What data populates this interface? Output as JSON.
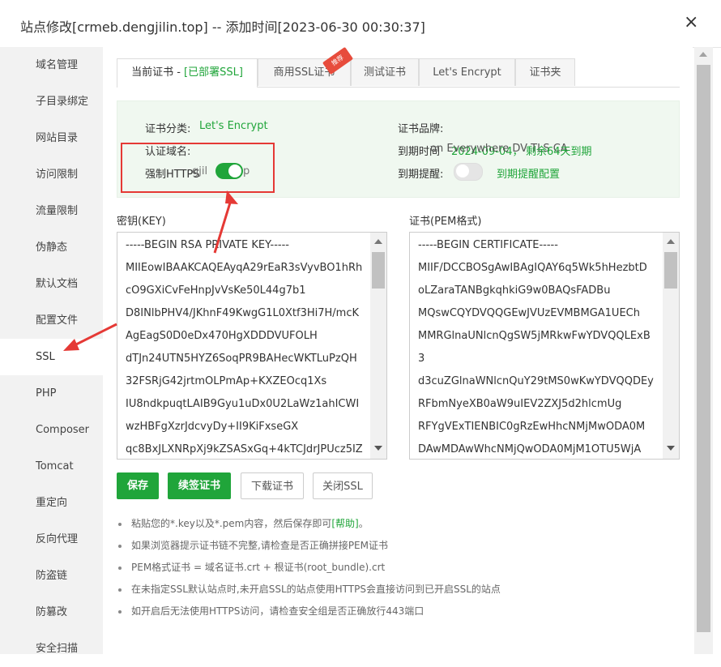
{
  "window": {
    "title": "站点修改[crmeb.dengjilin.top] -- 添加时间[2023-06-30 00:30:37]",
    "close_glyph": "×"
  },
  "sidebar": {
    "items": [
      {
        "label": "域名管理"
      },
      {
        "label": "子目录绑定"
      },
      {
        "label": "网站目录"
      },
      {
        "label": "访问限制"
      },
      {
        "label": "流量限制"
      },
      {
        "label": "伪静态"
      },
      {
        "label": "默认文档"
      },
      {
        "label": "配置文件"
      },
      {
        "label": "SSL",
        "active": true
      },
      {
        "label": "PHP"
      },
      {
        "label": "Composer"
      },
      {
        "label": "Tomcat"
      },
      {
        "label": "重定向"
      },
      {
        "label": "反向代理"
      },
      {
        "label": "防盗链"
      },
      {
        "label": "防篡改"
      },
      {
        "label": "安全扫描"
      }
    ]
  },
  "tabs": {
    "current_prefix": "当前证书 - ",
    "current_status": "[已部署SSL]",
    "commercial": "商用SSL证书",
    "hot_badge": "推荐",
    "test": "测试证书",
    "letsencrypt": "Let's Encrypt",
    "folder": "证书夹"
  },
  "cert_info": {
    "category_label": "证书分类:",
    "category_value": "Let's Encrypt",
    "domain_label": "认证域名:",
    "https_overlap_text": "强制HTTPS",
    "https_overlap_domain": "gjil",
    "https_overlap_tail": "p",
    "force_https_on": true,
    "brand_label": "证书品牌:",
    "expiry_overlap_text": "到期时间",
    "expiry_overlap_value": "2024-09-04，",
    "expiry_overlap_mid": "on Everywhere  DV TLS CA",
    "expiry_overlap_tail": "剩余64天到期",
    "remind_label": "到期提醒:",
    "remind_on": false,
    "remind_link": "到期提醒配置",
    "accent_color": "#20a53a"
  },
  "key_panel": {
    "label": "密钥(KEY)",
    "lines": [
      "-----BEGIN RSA PRIVATE KEY-----",
      "MIIEowIBAAKCAQEAyqA29rEaR3sVyvBO1hRh",
      "cO9GXiCvFeHnpJvVsKe50L44g7b1",
      "D8INlbPHV4/JKhnF49KwgG1L0Xtf3Hi7H/mcK",
      "AgEagS0D0eDx470HgXDDDVUFOLH",
      "dTJn24UTN5HYZ6SoqPR9BAHecWKTLuPzQH",
      "32FSRjG42jrtmOLPmAp+KXZEOcq1Xs",
      "IU8ndkpuqtLAIB9Gyu1uDx0U2LaWz1ahICWI",
      "wzHBFgXzrJdcvyDy+II9KiFxseGX",
      "qc8BxJLXNRpXj9kZSASxGq+4kTCJdrJPUcz5IZ"
    ]
  },
  "pem_panel": {
    "label": "证书(PEM格式)",
    "lines": [
      "-----BEGIN CERTIFICATE-----",
      "MIIF/DCCBOSgAwIBAgIQAY6q5Wk5hHezbtD",
      "oLZaraTANBgkqhkiG9w0BAQsFADBu",
      "MQswCQYDVQQGEwJVUzEVMBMGA1UECh",
      "MMRGlnaUNlcnQgSW5jMRkwFwYDVQQLExB",
      "3",
      "d3cuZGlnaWNlcnQuY29tMS0wKwYDVQQDEy",
      "RFbmNyeXB0aW9uIEV2ZXJ5d2hlcmUg",
      "RFYgVExTIENBIC0gRzEwHhcNMjMwODA0M",
      "DAwMDAwWhcNMjQwODA0MjM1OTU5WjA"
    ]
  },
  "buttons": {
    "save": "保存",
    "renew": "续签证书",
    "download": "下载证书",
    "close_ssl": "关闭SSL"
  },
  "notes": {
    "n1_text": "粘贴您的*.key以及*.pem内容，然后保存即可",
    "n1_link": "[帮助]",
    "n1_end": "。",
    "n2": "如果浏览器提示证书链不完整,请检查是否正确拼接PEM证书",
    "n3": "PEM格式证书 = 域名证书.crt + 根证书(root_bundle).crt",
    "n4": "在未指定SSL默认站点时,未开启SSL的站点使用HTTPS会直接访问到已开启SSL的站点",
    "n5": "如开启后无法使用HTTPS访问，请检查安全组是否正确放行443端口"
  }
}
